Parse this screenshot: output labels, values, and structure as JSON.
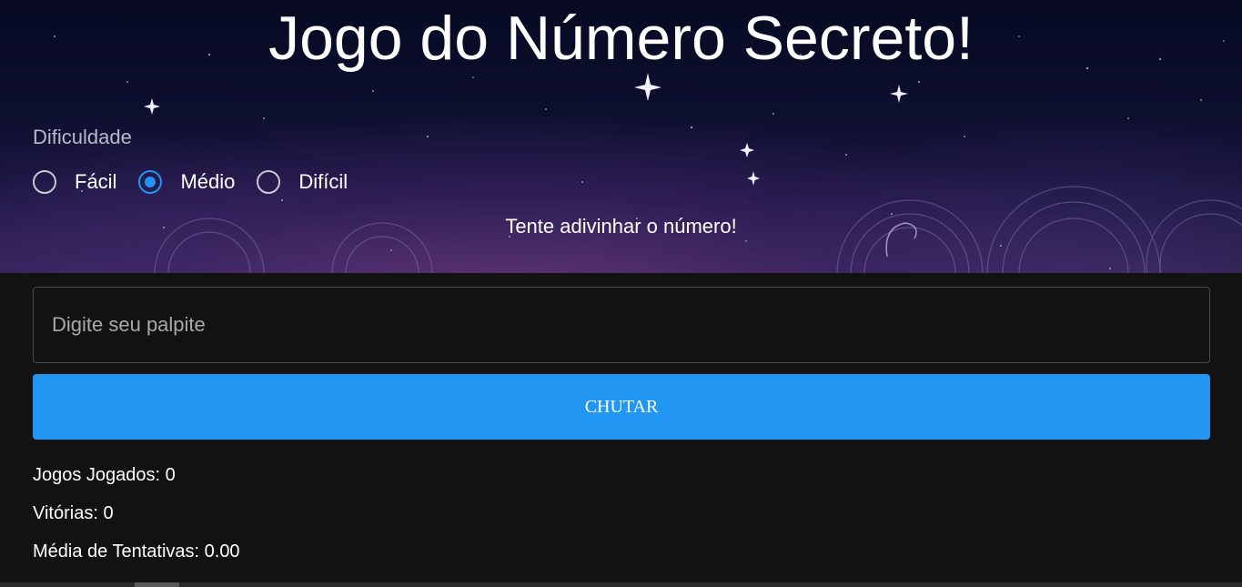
{
  "header": {
    "title": "Jogo do Número Secreto!"
  },
  "difficulty": {
    "label": "Dificuldade",
    "options": [
      {
        "label": "Fácil",
        "selected": false
      },
      {
        "label": "Médio",
        "selected": true
      },
      {
        "label": "Difícil",
        "selected": false
      }
    ]
  },
  "hint": "Tente adivinhar o número!",
  "guess": {
    "value": "",
    "placeholder": "Digite seu palpite"
  },
  "submit": {
    "label": "CHUTAR"
  },
  "stats": {
    "games_played": "Jogos Jogados: 0",
    "wins": "Vitórias: 0",
    "avg_attempts": "Média de Tentativas: 0.00"
  },
  "colors": {
    "accent": "#2196f3",
    "page_background": "#121212",
    "hero_top": "#070a22",
    "hero_bottom": "#2d1f4e"
  }
}
